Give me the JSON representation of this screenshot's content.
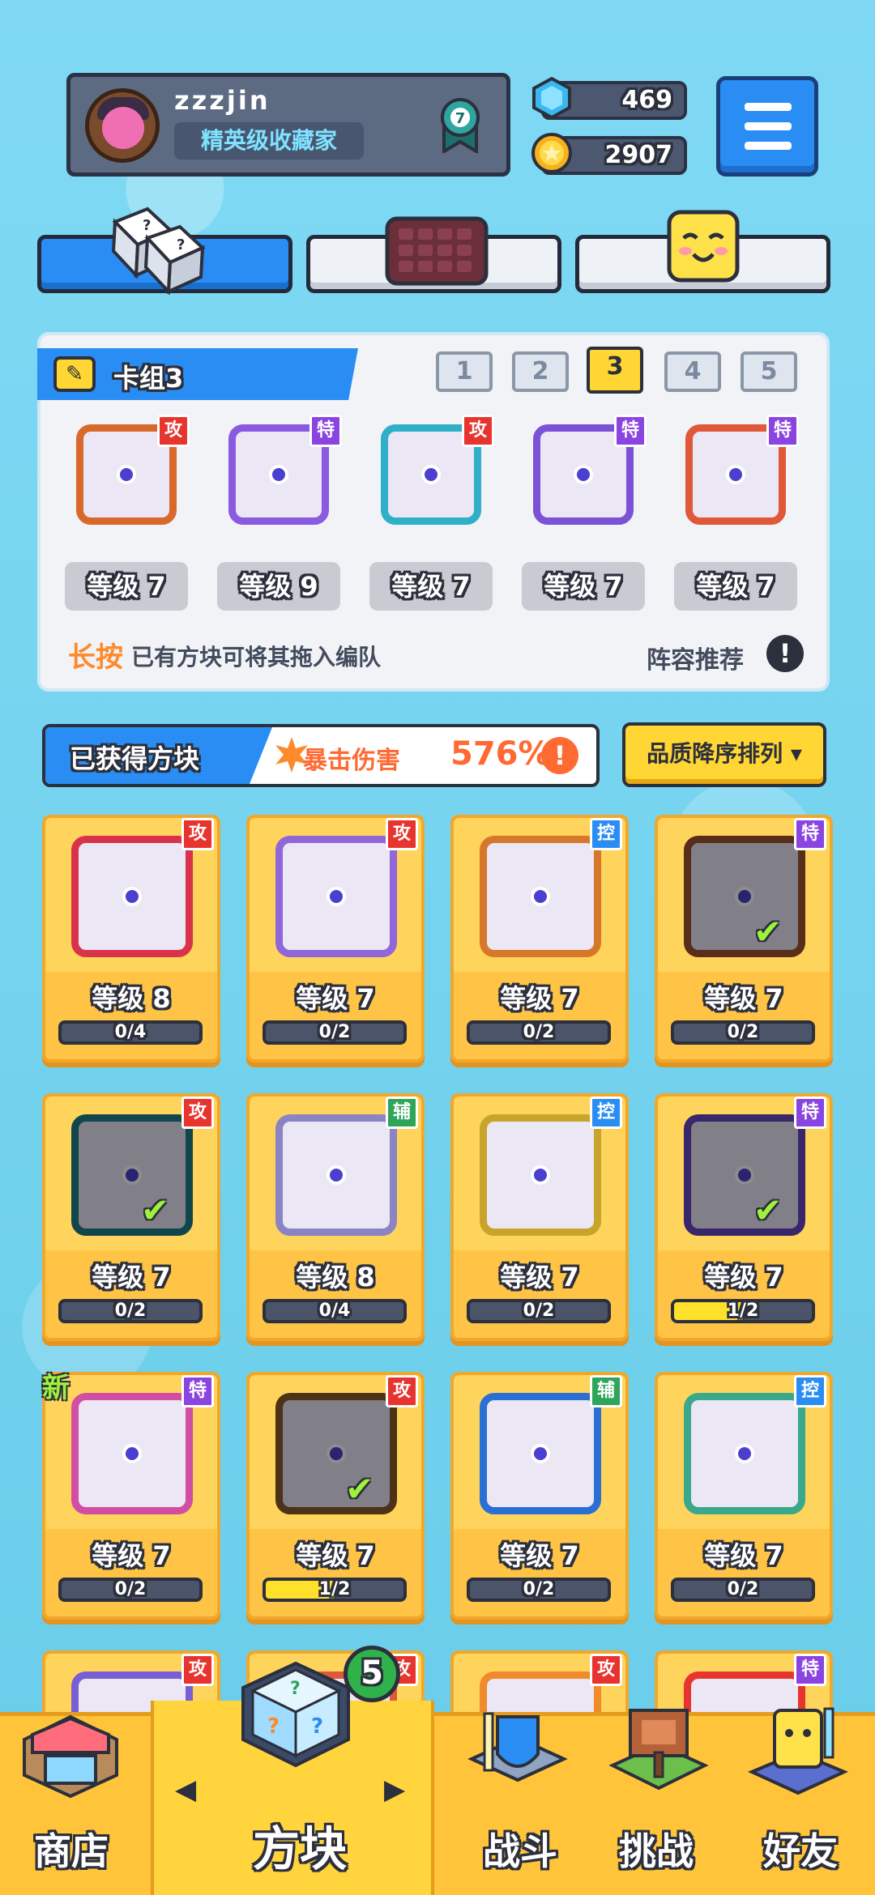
{
  "profile": {
    "username": "zzzjin",
    "title": "精英级收藏家",
    "rank": "7"
  },
  "currency": {
    "gems": "469",
    "coins": "2907"
  },
  "deck": {
    "title": "卡组3",
    "slots": [
      "1",
      "2",
      "3",
      "4",
      "5"
    ],
    "active_slot": "3",
    "cards": [
      {
        "tag": "攻",
        "tagtype": "atk",
        "level": "等级 7",
        "frame": "#d9692a"
      },
      {
        "tag": "特",
        "tagtype": "spe",
        "level": "等级 9",
        "frame": "#8a5ae0"
      },
      {
        "tag": "攻",
        "tagtype": "atk",
        "level": "等级 7",
        "frame": "#2fb0c8"
      },
      {
        "tag": "特",
        "tagtype": "spe",
        "level": "等级 7",
        "frame": "#7b52d6"
      },
      {
        "tag": "特",
        "tagtype": "spe",
        "level": "等级 7",
        "frame": "#e0583a"
      }
    ],
    "hint_emph": "长按",
    "hint_rest": "已有方块可将其拖入编队",
    "recommend": "阵容推荐"
  },
  "obtained": {
    "label": "已获得方块",
    "crit_label": "暴击伤害",
    "crit_value": "576%",
    "sort_label": "品质降序排列 ▾"
  },
  "grid": [
    {
      "tag": "攻",
      "tagtype": "atk",
      "level": "等级 8",
      "progress": "0/4",
      "fill": 0,
      "frame": "#d8334a",
      "check": false,
      "dim": false,
      "new": false
    },
    {
      "tag": "攻",
      "tagtype": "atk",
      "level": "等级 7",
      "progress": "0/2",
      "fill": 0,
      "frame": "#9066d8",
      "check": false,
      "dim": false,
      "new": false
    },
    {
      "tag": "控",
      "tagtype": "ctl",
      "level": "等级 7",
      "progress": "0/2",
      "fill": 0,
      "frame": "#d7772a",
      "check": false,
      "dim": false,
      "new": false
    },
    {
      "tag": "特",
      "tagtype": "spe",
      "level": "等级 7",
      "progress": "0/2",
      "fill": 0,
      "frame": "#a0522d",
      "check": true,
      "dim": true,
      "new": false
    },
    {
      "tag": "攻",
      "tagtype": "atk",
      "level": "等级 7",
      "progress": "0/2",
      "fill": 0,
      "frame": "#1f7f8a",
      "check": true,
      "dim": true,
      "new": false
    },
    {
      "tag": "辅",
      "tagtype": "sup",
      "level": "等级 8",
      "progress": "0/4",
      "fill": 0,
      "frame": "#8a84c4",
      "check": false,
      "dim": false,
      "new": false
    },
    {
      "tag": "控",
      "tagtype": "ctl",
      "level": "等级 7",
      "progress": "0/2",
      "fill": 0,
      "frame": "#c8a52a",
      "check": false,
      "dim": false,
      "new": false
    },
    {
      "tag": "特",
      "tagtype": "spe",
      "level": "等级 7",
      "progress": "1/2",
      "fill": 0.5,
      "frame": "#6a46c2",
      "check": true,
      "dim": true,
      "new": false
    },
    {
      "tag": "特",
      "tagtype": "spe",
      "level": "等级 7",
      "progress": "0/2",
      "fill": 0,
      "frame": "#d24ea2",
      "check": false,
      "dim": false,
      "new": true,
      "new_label": "新"
    },
    {
      "tag": "攻",
      "tagtype": "atk",
      "level": "等级 7",
      "progress": "1/2",
      "fill": 0.5,
      "frame": "#8a5a2a",
      "check": true,
      "dim": true,
      "new": false
    },
    {
      "tag": "辅",
      "tagtype": "sup",
      "level": "等级 7",
      "progress": "0/2",
      "fill": 0,
      "frame": "#2a6fd4",
      "check": false,
      "dim": false,
      "new": false
    },
    {
      "tag": "控",
      "tagtype": "ctl",
      "level": "等级 7",
      "progress": "0/2",
      "fill": 0,
      "frame": "#3aa88a",
      "check": false,
      "dim": false,
      "new": false
    },
    {
      "tag": "攻",
      "tagtype": "atk",
      "frame": "#7a5fd4"
    },
    {
      "tag": "攻",
      "tagtype": "atk",
      "frame": "#e0583a"
    },
    {
      "tag": "攻",
      "tagtype": "atk",
      "frame": "#f08a2a"
    },
    {
      "tag": "特",
      "tagtype": "spe",
      "frame": "#e8342f"
    }
  ],
  "nav": {
    "shop": "商店",
    "blocks": "方块",
    "blocks_badge": "5",
    "battle": "战斗",
    "challenge": "挑战",
    "friends": "好友"
  },
  "colors": {
    "accent": "#2a8df4",
    "gold": "#ffc43a",
    "outline": "#2c2f3c"
  }
}
